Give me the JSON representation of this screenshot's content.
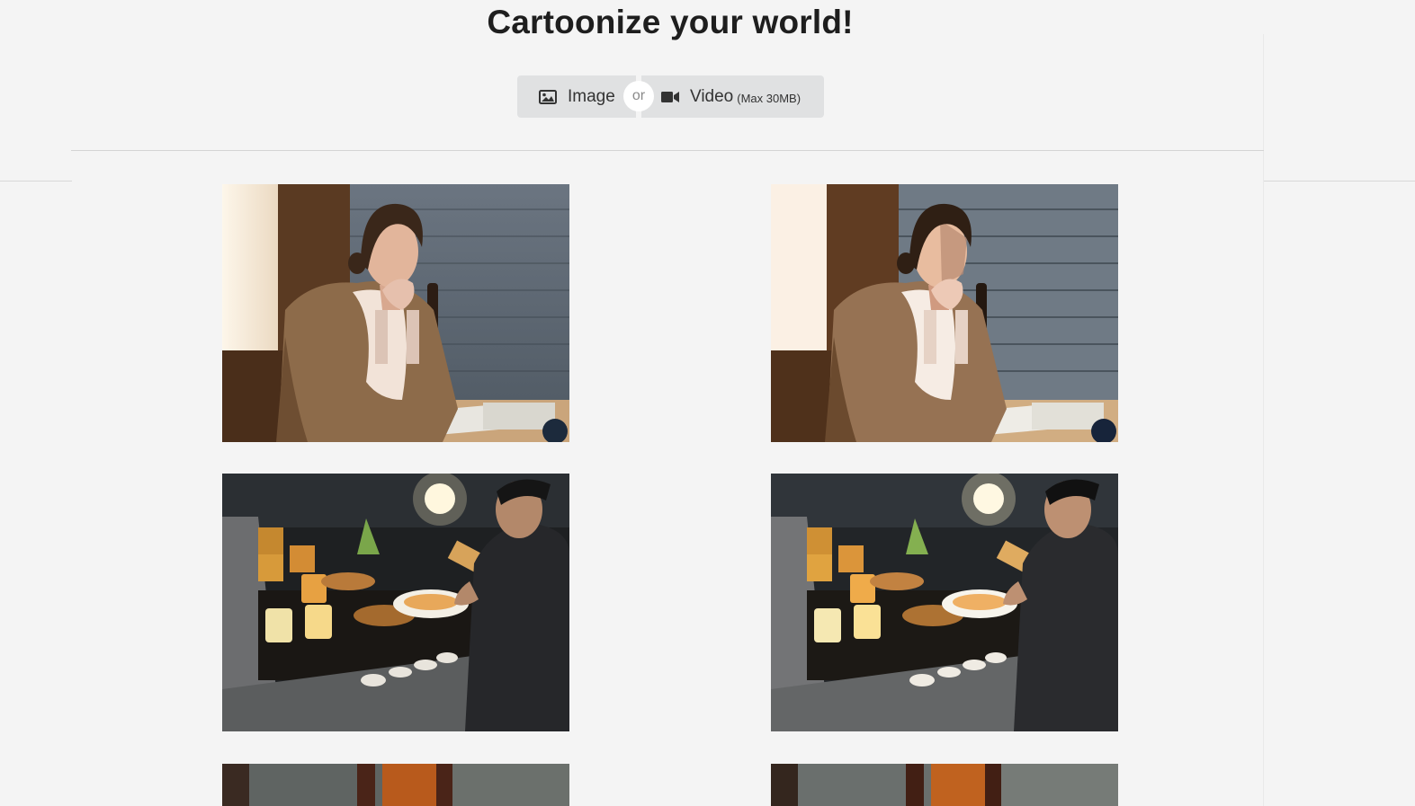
{
  "header": {
    "title": "Cartoonize your world!"
  },
  "upload": {
    "image_label": "Image",
    "or_label": "or",
    "video_label": "Video",
    "video_note": "(Max 30MB)"
  },
  "gallery": [
    {
      "original": "photo-woman-shawl-original",
      "cartoon": "photo-woman-shawl-cartoonized"
    },
    {
      "original": "photo-man-food-table-original",
      "cartoon": "photo-man-food-table-cartoonized"
    },
    {
      "original": "photo-third-original",
      "cartoon": "photo-third-cartoonized"
    }
  ],
  "colors": {
    "background": "#f4f4f4",
    "button": "#e0e1e2",
    "title": "#1e1e1e"
  },
  "icons": {
    "image_button": "image-icon",
    "video_button": "video-camera-icon"
  }
}
